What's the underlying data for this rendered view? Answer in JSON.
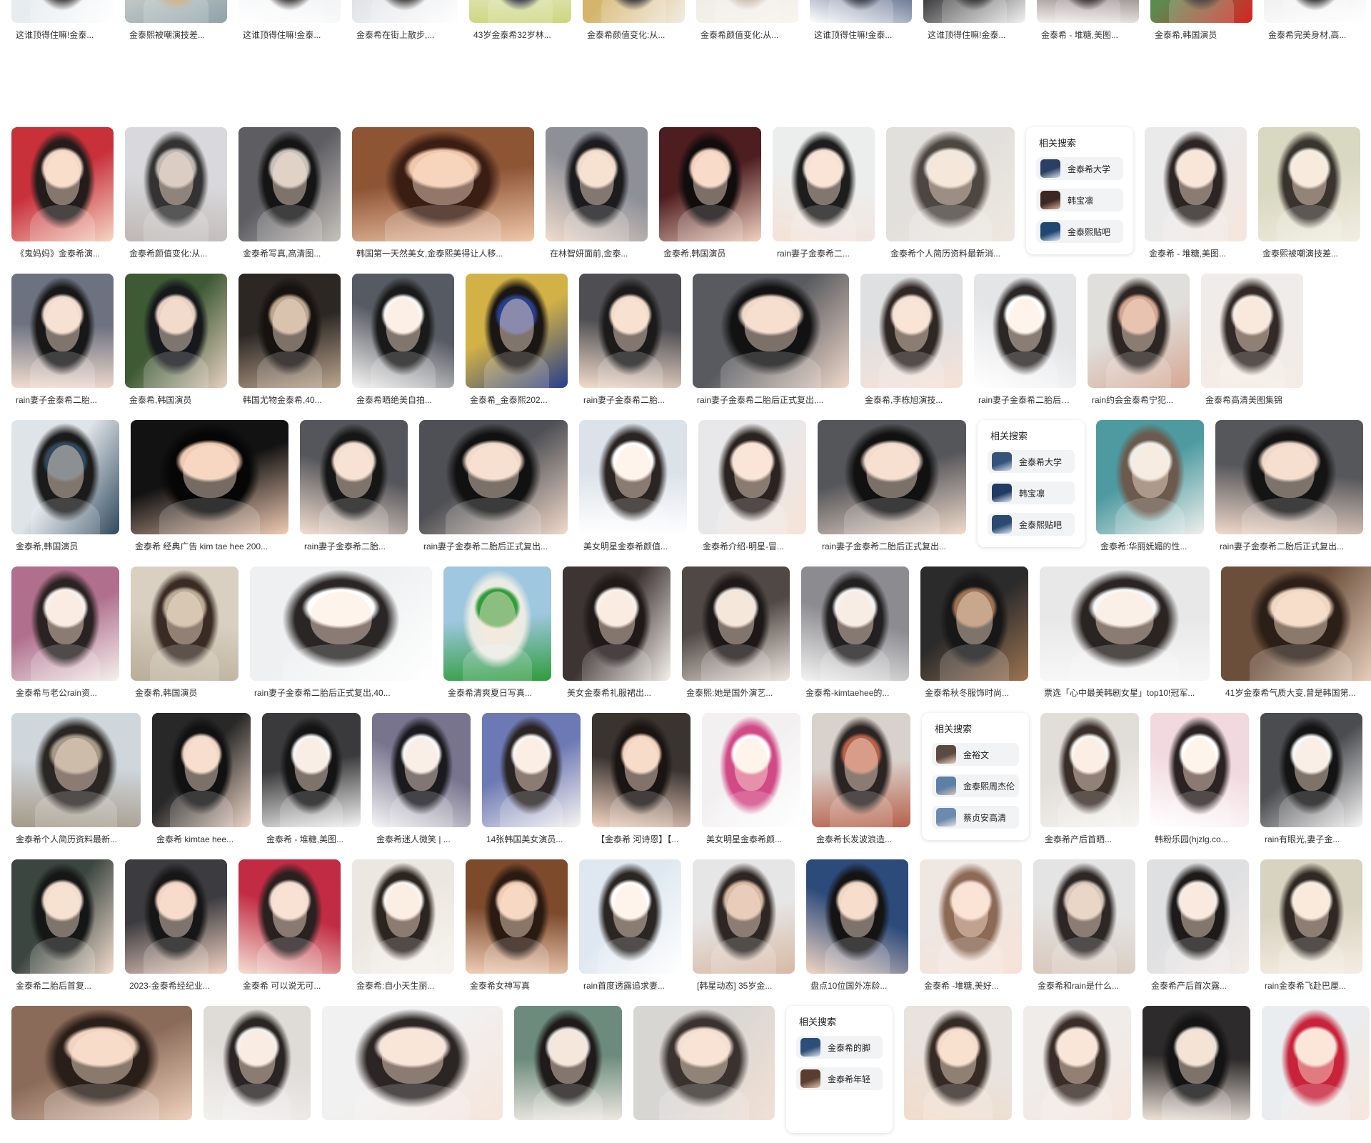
{
  "rows": [
    [
      {
        "caption": "这谁顶得住嘛!金泰...",
        "palette": [
          "#e7ecf1",
          "#ffffff",
          "#2a2523"
        ]
      },
      {
        "caption": "金泰熙被嘲演技差...",
        "palette": [
          "#cfd4cf",
          "#8ea2a9",
          "#c5a57a"
        ]
      },
      {
        "caption": "这谁顶得住嘛!金泰...",
        "palette": [
          "#e9ecef",
          "#ffffff",
          "#2a2523"
        ]
      },
      {
        "caption": "金泰希在街上散步,...",
        "palette": [
          "#dfe2e6",
          "#ffffff",
          "#2d2826"
        ]
      },
      {
        "caption": "43岁金泰希32岁林...",
        "palette": [
          "#f1f3ef",
          "#ccd67c",
          "#1d2137"
        ]
      },
      {
        "caption": "金泰希颜值变化:从...",
        "palette": [
          "#d5b46b",
          "#f2ede5",
          "#1b1a1c"
        ]
      },
      {
        "caption": "金泰希颜值变化:从...",
        "palette": [
          "#ece8e3",
          "#f8f4ee",
          "#c8b6a4"
        ]
      },
      {
        "caption": "这谁顶得住嘛!金泰...",
        "palette": [
          "#344770",
          "#ffffff",
          "#1e2230"
        ]
      },
      {
        "caption": "这谁顶得住嘛!金泰...",
        "palette": [
          "#2c2c2e",
          "#f3f3f3",
          "#151515"
        ]
      },
      {
        "caption": "金泰希 - 堆糖,美图...",
        "palette": [
          "#3f2a27",
          "#f2f0ef",
          "#201716"
        ]
      },
      {
        "caption": "金泰希,韩国演员",
        "palette": [
          "#5b8b4e",
          "#d92323",
          "#2a2220"
        ]
      },
      {
        "caption": "金泰希完美身材,高...",
        "palette": [
          "#e7e7e7",
          "#ffffff",
          "#1d1d1d"
        ]
      }
    ],
    [
      {
        "caption": "《鬼妈妈》金泰希演...",
        "palette": [
          "#c8303a",
          "#f6d7c5",
          "#241c1b"
        ]
      },
      {
        "caption": "金泰希颜值变化:从...",
        "palette": [
          "#d9d9dd",
          "#bfb8b4",
          "#333333"
        ]
      },
      {
        "caption": "金泰希写真,高清图...",
        "palette": [
          "#5d5d62",
          "#c7c2bb",
          "#151515"
        ]
      },
      {
        "caption": "韩国第一天然美女,金泰熙美得让人移...",
        "palette": [
          "#8e5535",
          "#f1c7aa",
          "#3b1e13"
        ]
      },
      {
        "caption": "在林智妍面前,金泰...",
        "palette": [
          "#8d9097",
          "#f0dccd",
          "#1c1c1f"
        ]
      },
      {
        "caption": "金泰希,韩国演员",
        "palette": [
          "#4d1d20",
          "#f2d2c0",
          "#120d0d"
        ]
      },
      {
        "caption": "rain妻子金泰希二...",
        "palette": [
          "#eceeed",
          "#f4e2d7",
          "#1d1d1d"
        ]
      },
      {
        "caption": "金泰希个人简历资料最新消...",
        "palette": [
          "#e2e0dc",
          "#efe8e0",
          "#4d4641"
        ]
      },
      {
        "related": true,
        "title": "相关搜索",
        "items": [
          {
            "label": "金泰希大学",
            "palette": [
              "#2a3f63",
              "#dbe3ef"
            ]
          },
          {
            "label": "韩宝凛",
            "palette": [
              "#3c2721",
              "#d9b39c"
            ]
          },
          {
            "label": "金泰熙贴吧",
            "palette": [
              "#1f4770",
              "#e0e8f3"
            ]
          }
        ]
      },
      {
        "caption": "金泰希 - 堆糖,美图...",
        "palette": [
          "#ebeaea",
          "#f6e6dc",
          "#2c2523"
        ]
      },
      {
        "caption": "金泰熙被嘲演技差...",
        "palette": [
          "#d9d8c0",
          "#f3eee3",
          "#3a342f"
        ]
      }
    ],
    [
      {
        "caption": "rain妻子金泰希二胎...",
        "palette": [
          "#6d7281",
          "#f1dccf",
          "#181818"
        ]
      },
      {
        "caption": "金泰希,韩国演员",
        "palette": [
          "#3d5a34",
          "#e8d1c2",
          "#16181c"
        ]
      },
      {
        "caption": "韩国尤物金泰希,40...",
        "palette": [
          "#2d2724",
          "#bca68e",
          "#151210"
        ]
      },
      {
        "caption": "金泰希晒绝美自拍...",
        "palette": [
          "#565a62",
          "#f7f6f4",
          "#1a1a1a"
        ]
      },
      {
        "caption": "金泰希_金泰熙202...",
        "palette": [
          "#d2b146",
          "#283e8a",
          "#1a1613"
        ]
      },
      {
        "caption": "rain妻子金泰希二胎...",
        "palette": [
          "#4f4f53",
          "#f2dccc",
          "#1c1b1b"
        ]
      },
      {
        "caption": "rain妻子金泰希二胎后正式复出,...",
        "palette": [
          "#585a5f",
          "#efd9ca",
          "#121212"
        ]
      },
      {
        "caption": "金泰希,李栋旭演技...",
        "palette": [
          "#dfe0e2",
          "#f5e2d6",
          "#2f2724"
        ]
      },
      {
        "caption": "rain妻子金泰希二胎后正式复出,...",
        "palette": [
          "#e4e5e7",
          "#ffffff",
          "#2b2727"
        ]
      },
      {
        "caption": "rain约会金泰希宁犯...",
        "palette": [
          "#e0dfdc",
          "#d5a792",
          "#2d2522"
        ]
      },
      {
        "caption": "金泰希高清美图集锦",
        "palette": [
          "#f0ecea",
          "#f5ece4",
          "#332a27"
        ]
      }
    ],
    [
      {
        "caption": "金泰希,韩国演员",
        "palette": [
          "#dfe4e8",
          "#30495d",
          "#1b1b1b"
        ]
      },
      {
        "caption": "金泰希 经典广告 kim tae hee 200...",
        "palette": [
          "#121212",
          "#f0cbb3",
          "#060606"
        ]
      },
      {
        "caption": "rain妻子金泰希二胎...",
        "palette": [
          "#55565b",
          "#f3dfd1",
          "#161616"
        ]
      },
      {
        "caption": "rain妻子金泰希二胎后正式复出...",
        "palette": [
          "#4f5055",
          "#f0dacb",
          "#111111"
        ]
      },
      {
        "caption": "美女明星金泰希颜值...",
        "palette": [
          "#dbe2ea",
          "#ffffff",
          "#2a2422"
        ]
      },
      {
        "caption": "金泰希介绍-明星-冒...",
        "palette": [
          "#e8e8ea",
          "#f6e4d8",
          "#2b2320"
        ]
      },
      {
        "caption": "rain妻子金泰希二胎后正式复出...",
        "palette": [
          "#55565a",
          "#f1dbcc",
          "#111111"
        ]
      },
      {
        "related": true,
        "title": "相关搜索",
        "items": [
          {
            "label": "金泰希大学",
            "palette": [
              "#34527a",
              "#d6dfeb"
            ]
          },
          {
            "label": "韩宝凛",
            "palette": [
              "#203b63",
              "#e6ebf2"
            ]
          },
          {
            "label": "金泰熙贴吧",
            "palette": [
              "#2a4a72",
              "#dce5ef"
            ]
          }
        ]
      },
      {
        "caption": "金泰希:华丽妩媚的性...",
        "palette": [
          "#4d9aa0",
          "#eef0ec",
          "#6b5a4d"
        ]
      },
      {
        "caption": "rain妻子金泰希二胎后正式复出...",
        "palette": [
          "#56575b",
          "#f0d9ca",
          "#141414"
        ]
      }
    ],
    [
      {
        "caption": "金泰希与老公rain资...",
        "palette": [
          "#b06f8d",
          "#f6f1ee",
          "#2b2323"
        ]
      },
      {
        "caption": "金泰希,韩国演员",
        "palette": [
          "#d9d0c2",
          "#b9ad97",
          "#3a2c25"
        ]
      },
      {
        "caption": "rain妻子金泰希二胎后正式复出,40...",
        "palette": [
          "#eef0f1",
          "#ffffff",
          "#2a2626"
        ]
      },
      {
        "caption": "金泰希清爽夏日写真...",
        "palette": [
          "#9fc7e0",
          "#2f9d3b",
          "#ecebe3"
        ]
      },
      {
        "caption": "美女金泰希礼服裙出...",
        "palette": [
          "#3d3433",
          "#f7f1ec",
          "#1f1918"
        ]
      },
      {
        "caption": "金泰熙:她是国外演艺...",
        "palette": [
          "#504845",
          "#efe7e0",
          "#1d1918"
        ]
      },
      {
        "caption": "金泰希-kimtaehee的...",
        "palette": [
          "#8b8b90",
          "#f3f3f3",
          "#232021"
        ]
      },
      {
        "caption": "金泰希秋冬服饰时尚...",
        "palette": [
          "#2b2b2b",
          "#9d7451",
          "#171717"
        ]
      },
      {
        "caption": "票选「心中最美韩剧女星」top10!冠军...",
        "palette": [
          "#e8e8e8",
          "#f7f7f7",
          "#2a2523"
        ]
      },
      {
        "caption": "41岁金泰希气质大变,曾是韩国第...",
        "palette": [
          "#6b4f3b",
          "#efd7c4",
          "#2c1f17"
        ]
      }
    ],
    [
      {
        "caption": "金泰希个人简历资料最新...",
        "palette": [
          "#cfd6dc",
          "#a59a87",
          "#2a2623"
        ]
      },
      {
        "caption": "金泰希 kimtae hee...",
        "palette": [
          "#282828",
          "#f0d7c8",
          "#111111"
        ]
      },
      {
        "caption": "金泰希 - 堆糖,美图...",
        "palette": [
          "#3a3a3c",
          "#f5f5f5",
          "#141414"
        ]
      },
      {
        "caption": "金泰希迷人微笑 | ...",
        "palette": [
          "#78748e",
          "#f6f6f6",
          "#1b1b1f"
        ]
      },
      {
        "caption": "14张韩国美女演员...",
        "palette": [
          "#6d79b4",
          "#f8f5f3",
          "#2a2424"
        ]
      },
      {
        "caption": "【金泰希 河诗恩】【...",
        "palette": [
          "#3a3431",
          "#f2d4c1",
          "#1a1412"
        ]
      },
      {
        "caption": "美女明星金泰希颜...",
        "palette": [
          "#f3f0f2",
          "#ffffff",
          "#d14a86"
        ]
      },
      {
        "caption": "金泰希长发波浪造...",
        "palette": [
          "#d9d2cc",
          "#b7614a",
          "#2a2423"
        ]
      },
      {
        "related": true,
        "title": "相关搜索",
        "items": [
          {
            "label": "金裕文",
            "palette": [
              "#5a4a3f",
              "#e8d3c3"
            ]
          },
          {
            "label": "金泰熙周杰伦",
            "palette": [
              "#5c7fa8",
              "#d8c4b5"
            ]
          },
          {
            "label": "蔡贞安高清",
            "palette": [
              "#6c8ab1",
              "#e8e0da"
            ]
          }
        ]
      },
      {
        "caption": "金泰希产后首晒...",
        "palette": [
          "#e1ddd8",
          "#f7f6f3",
          "#3a2f28"
        ]
      },
      {
        "caption": "韩粉乐园(hjzlg.co...",
        "palette": [
          "#f1d9df",
          "#ffffff",
          "#2b2223"
        ]
      },
      {
        "caption": "rain有眼光,妻子金...",
        "palette": [
          "#4b4c50",
          "#f6f6f6",
          "#141414"
        ]
      }
    ],
    [
      {
        "caption": "金泰希二胎后首复...",
        "palette": [
          "#3b4640",
          "#f1dccd",
          "#141716"
        ]
      },
      {
        "caption": "2023-金泰希经纪业...",
        "palette": [
          "#3c3c40",
          "#f3d3c3",
          "#161616"
        ]
      },
      {
        "caption": "金泰希 可以说无可...",
        "palette": [
          "#c12b43",
          "#f4dfd2",
          "#2a2020"
        ]
      },
      {
        "caption": "金泰希:自小天生丽...",
        "palette": [
          "#ece7e1",
          "#f8f4ef",
          "#2c2420"
        ]
      },
      {
        "caption": "金泰希女神写真",
        "palette": [
          "#7d4a2c",
          "#efcdb4",
          "#2b1a12"
        ]
      },
      {
        "caption": "rain首度透露追求妻...",
        "palette": [
          "#dfe8f1",
          "#ffffff",
          "#2a2624"
        ]
      },
      {
        "caption": "[韩星动态] 35岁金...",
        "palette": [
          "#e6e6e6",
          "#d7b9a4",
          "#2e2623"
        ]
      },
      {
        "caption": "盘点10位国外冻龄...",
        "palette": [
          "#2c4a7a",
          "#f1d6c4",
          "#141414"
        ]
      },
      {
        "caption": "金泰希 -堆糖,美好...",
        "palette": [
          "#efe7e2",
          "#f7e2d8",
          "#8c6a55"
        ]
      },
      {
        "caption": "金泰希和rain是什么...",
        "palette": [
          "#e4e4e4",
          "#d8c8bb",
          "#2d2726"
        ]
      },
      {
        "caption": "金泰希产后首次露...",
        "palette": [
          "#dfe0e2",
          "#f4ece7",
          "#1d1a19"
        ]
      },
      {
        "caption": "rain金泰希飞赴巴厘...",
        "palette": [
          "#d8d2c0",
          "#f5ede2",
          "#2f2823"
        ]
      }
    ],
    [
      {
        "caption": "",
        "palette": [
          "#8a6a58",
          "#f1d3bf",
          "#2a1f18"
        ]
      },
      {
        "caption": "",
        "palette": [
          "#dfdcd8",
          "#f3f1ee",
          "#2a2524"
        ]
      },
      {
        "caption": "",
        "palette": [
          "#f1f1f1",
          "#f6e5db",
          "#2b2524"
        ]
      },
      {
        "caption": "",
        "palette": [
          "#6c8b7c",
          "#ede8e1",
          "#1f1b1a"
        ]
      },
      {
        "caption": "",
        "palette": [
          "#d8d6d3",
          "#f2e0d5",
          "#3a322e"
        ]
      },
      {
        "related": true,
        "title": "相关搜索",
        "items": [
          {
            "label": "金泰希的脚",
            "palette": [
              "#2c4e78",
              "#dbe2ec"
            ]
          },
          {
            "label": "金泰希年轻",
            "palette": [
              "#5a3d30",
              "#e7c9b5"
            ]
          }
        ]
      },
      {
        "caption": "",
        "palette": [
          "#e8e3de",
          "#f3dcca",
          "#352a24"
        ]
      },
      {
        "caption": "",
        "palette": [
          "#f0ecea",
          "#f6e6dc",
          "#3a2d27"
        ]
      },
      {
        "caption": "",
        "palette": [
          "#2d2b2b",
          "#ede2d8",
          "#141414"
        ]
      },
      {
        "caption": "",
        "palette": [
          "#e9edf0",
          "#f7e6dc",
          "#c8233a"
        ]
      }
    ]
  ]
}
